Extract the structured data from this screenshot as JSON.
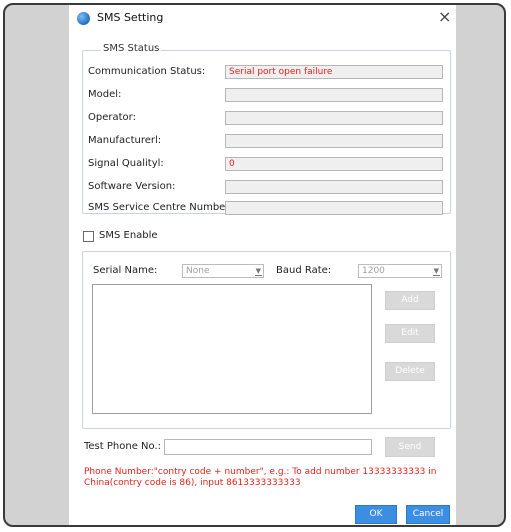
{
  "window": {
    "title": "SMS Setting",
    "close_symbol": "×"
  },
  "sms_status": {
    "legend": "SMS Status",
    "rows": [
      {
        "label": "Communication Status:",
        "value": "Serial port open failure",
        "error": true
      },
      {
        "label": "Model:",
        "value": ""
      },
      {
        "label": "Operator:",
        "value": ""
      },
      {
        "label": "Manufacturerl:",
        "value": ""
      },
      {
        "label": "Signal Qualityl:",
        "value": "0",
        "error": true
      },
      {
        "label": "Software Version:",
        "value": ""
      },
      {
        "label": "SMS Service Centre Number:",
        "value": ""
      }
    ]
  },
  "sms_enable": {
    "label": "SMS Enable",
    "checked": false
  },
  "serial": {
    "serial_name_label": "Serial Name:",
    "serial_name_value": "None",
    "baud_rate_label": "Baud Rate:",
    "baud_rate_value": "1200",
    "dropdown_symbol": "▼",
    "add_label": "Add",
    "edit_label": "Edit",
    "delete_label": "Delete"
  },
  "test": {
    "phone_label": "Test Phone No.:",
    "phone_value": "",
    "send_label": "Send"
  },
  "hint_text": "Phone Number:\"contry code + number\", e.g.: To add number 13333333333 in China(contry code is 86), input 8613333333333",
  "footer": {
    "ok_label": "OK",
    "cancel_label": "Cancel"
  },
  "colors": {
    "error": "#e2231a",
    "accent": "#3c8ee3",
    "disabled": "#d9d9d9",
    "frame": "#d2d2d2"
  },
  "icons": {
    "app": "sms-setting-app-icon",
    "close": "close-icon"
  }
}
